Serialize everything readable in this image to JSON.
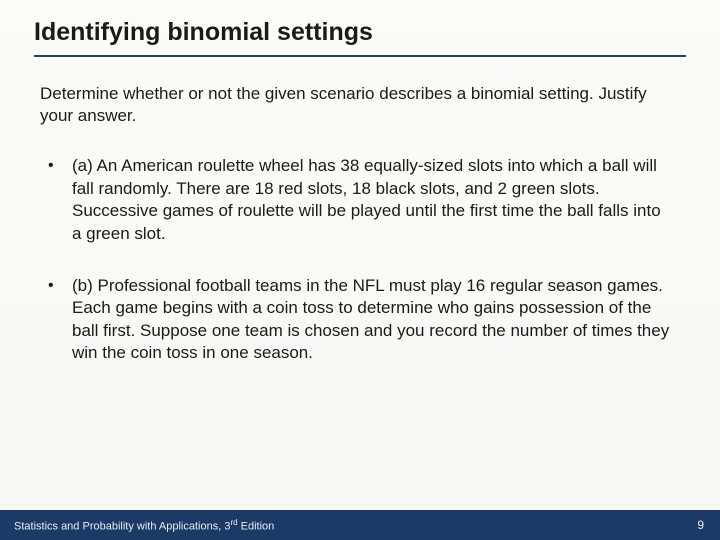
{
  "slide": {
    "title": "Identifying binomial settings",
    "intro": " Determine whether or not the given scenario describes a binomial setting. Justify your answer.",
    "bullets": [
      "(a) An American roulette wheel has 38 equally-sized slots into which a ball will fall randomly. There are 18 red slots, 18 black slots, and 2 green slots. Successive games of roulette will be played until the first time the ball falls into a green slot.",
      "(b) Professional football teams in the NFL must play 16 regular season games. Each game begins with a coin toss to determine who gains possession of the ball first. Suppose one team is chosen and you record the number of times they win the coin toss in one season."
    ]
  },
  "footer": {
    "text_prefix": "Statistics and Probability with Applications, 3",
    "text_suffix": " Edition",
    "ord": "rd",
    "page": "9"
  }
}
